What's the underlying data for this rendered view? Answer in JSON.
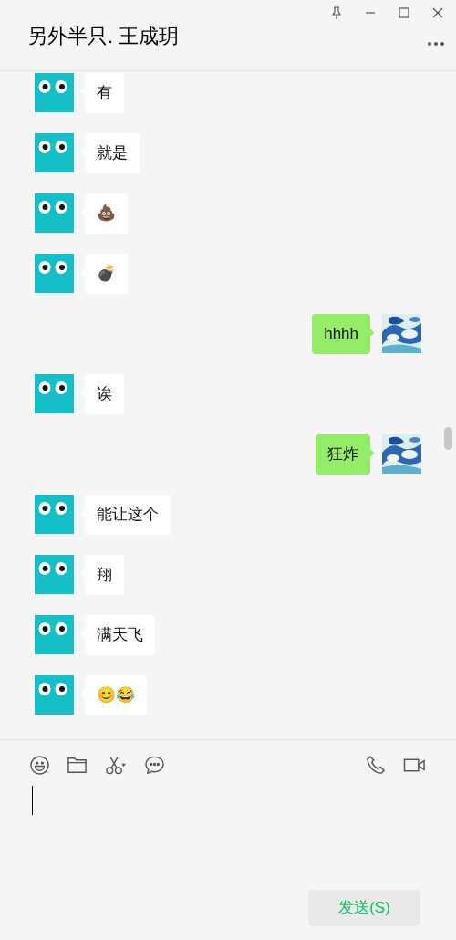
{
  "window": {
    "title": "另外半只. 王成玥"
  },
  "messages": [
    {
      "outgoing": false,
      "text": "有"
    },
    {
      "outgoing": false,
      "text": "就是"
    },
    {
      "outgoing": false,
      "text": "💩"
    },
    {
      "outgoing": false,
      "text": "💣"
    },
    {
      "outgoing": true,
      "text": "hhhh"
    },
    {
      "outgoing": false,
      "text": "诶"
    },
    {
      "outgoing": true,
      "text": "狂炸"
    },
    {
      "outgoing": false,
      "text": "能让这个"
    },
    {
      "outgoing": false,
      "text": "翔"
    },
    {
      "outgoing": false,
      "text": "满天飞"
    },
    {
      "outgoing": false,
      "text": "😊😂"
    }
  ],
  "composer": {
    "send_button": "发送(S)"
  }
}
